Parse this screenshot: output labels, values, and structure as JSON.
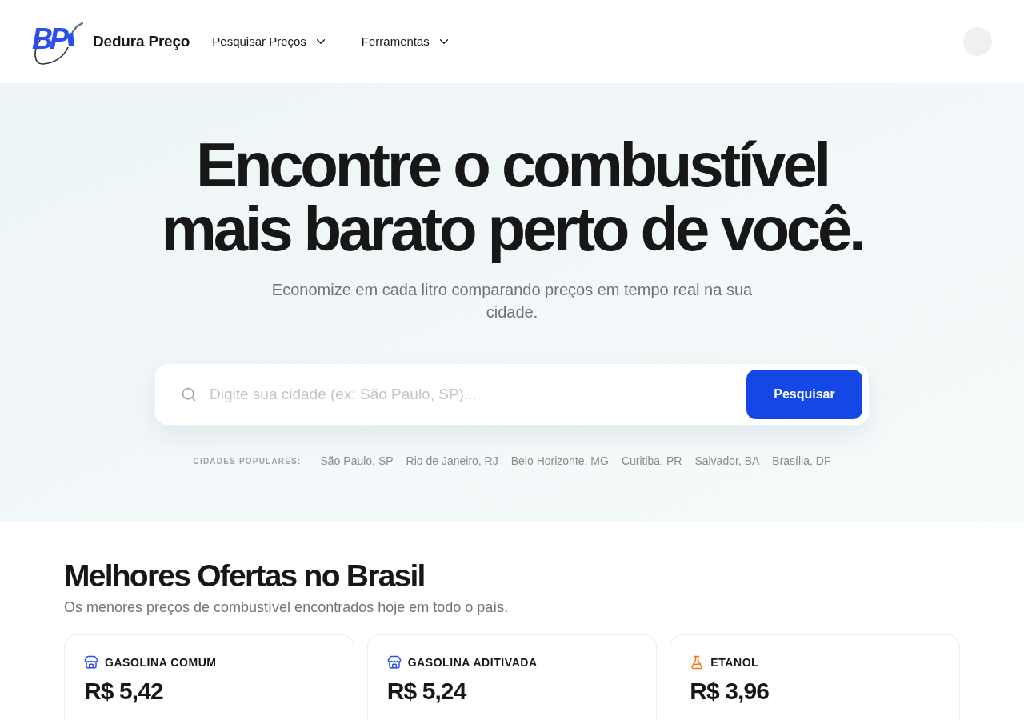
{
  "header": {
    "logo_letters": "BP",
    "brand": "Dedura Preço",
    "menu": [
      {
        "label": "Pesquisar Preços"
      },
      {
        "label": "Ferramentas"
      }
    ]
  },
  "hero": {
    "title_lines": [
      "Encontre o combustível",
      "mais barato perto de você."
    ],
    "subtitle": "Economize em cada litro comparando preços em tempo real na sua cidade.",
    "search": {
      "placeholder": "Digite sua cidade (ex: São Paulo, SP)...",
      "button": "Pesquisar"
    },
    "popular": {
      "label": "CIDADES POPULARES:",
      "cities": [
        "São Paulo, SP",
        "Rio de Janeiro, RJ",
        "Belo Horizonte, MG",
        "Curitiba, PR",
        "Salvador, BA",
        "Brasília, DF"
      ]
    }
  },
  "offers": {
    "title": "Melhores Ofertas no Brasil",
    "subtitle": "Os menores preços de combustível encontrados hoje em todo o país.",
    "cards": [
      {
        "kind": "gasoline",
        "fuel": "GASOLINA COMUM",
        "price": "R$ 5,42"
      },
      {
        "kind": "gasoline",
        "fuel": "GASOLINA ADITIVADA",
        "price": "R$ 5,24"
      },
      {
        "kind": "ethanol",
        "fuel": "ETANOL",
        "price": "R$ 3,96"
      }
    ]
  }
}
